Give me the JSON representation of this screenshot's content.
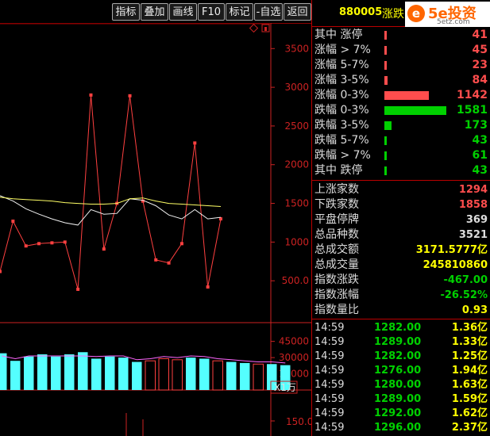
{
  "toolbar": {
    "buttons": [
      "指标",
      "叠加",
      "画线",
      "F10",
      "标记",
      "-自选",
      "返回"
    ]
  },
  "header": {
    "code": "880005",
    "name": "涨跌",
    "logo_text": "5e投资",
    "logo_sub": "5etz.com"
  },
  "colors": {
    "up": "#ff4d4d",
    "down": "#00d000",
    "yellow": "#ffff00",
    "axis": "#cc2222"
  },
  "price_axis": {
    "ticks": [
      "3500",
      "3000",
      "2500",
      "2000",
      "1500",
      "1000",
      "500.0"
    ]
  },
  "volume_axis": {
    "ticks": [
      "45000",
      "30000",
      "15000"
    ],
    "unit": "X1万",
    "lower_tick": "150.0"
  },
  "distribution": [
    {
      "label": "其中 涨停",
      "value": "41",
      "kind": "up",
      "count": 41
    },
    {
      "label": "涨幅 > 7%",
      "value": "45",
      "kind": "up",
      "count": 45
    },
    {
      "label": "涨幅 5-7%",
      "value": "23",
      "kind": "up",
      "count": 23
    },
    {
      "label": "涨幅 3-5%",
      "value": "84",
      "kind": "up",
      "count": 84
    },
    {
      "label": "涨幅 0-3%",
      "value": "1142",
      "kind": "up",
      "count": 1142
    },
    {
      "label": "跌幅 0-3%",
      "value": "1581",
      "kind": "down",
      "count": 1581
    },
    {
      "label": "跌幅 3-5%",
      "value": "173",
      "kind": "down",
      "count": 173
    },
    {
      "label": "跌幅 5-7%",
      "value": "43",
      "kind": "down",
      "count": 43
    },
    {
      "label": "跌幅 > 7%",
      "value": "61",
      "kind": "down",
      "count": 61
    },
    {
      "label": "其中 跌停",
      "value": "43",
      "kind": "down",
      "count": 43
    }
  ],
  "stats": [
    {
      "label": "上涨家数",
      "value": "1294",
      "color": "#ff4d4d"
    },
    {
      "label": "下跌家数",
      "value": "1858",
      "color": "#ff4d4d"
    },
    {
      "label": "平盘停牌",
      "value": "369",
      "color": "#dddddd"
    },
    {
      "label": "总品种数",
      "value": "3521",
      "color": "#dddddd"
    },
    {
      "label": "总成交额",
      "value": "3171.5777亿",
      "color": "#ffff00"
    },
    {
      "label": "总成交量",
      "value": "245810860",
      "color": "#ffff00"
    },
    {
      "label": "指数涨跌",
      "value": "-467.00",
      "color": "#00d000"
    },
    {
      "label": "指数涨幅",
      "value": "-26.52%",
      "color": "#00d000"
    },
    {
      "label": "指数量比",
      "value": "0.93",
      "color": "#ffff00"
    }
  ],
  "ticks": [
    {
      "time": "14:59",
      "price": "1282.00",
      "amount": "1.36亿"
    },
    {
      "time": "14:59",
      "price": "1289.00",
      "amount": "1.33亿"
    },
    {
      "time": "14:59",
      "price": "1282.00",
      "amount": "1.25亿"
    },
    {
      "time": "14:59",
      "price": "1276.00",
      "amount": "1.94亿"
    },
    {
      "time": "14:59",
      "price": "1280.00",
      "amount": "1.63亿"
    },
    {
      "time": "14:59",
      "price": "1289.00",
      "amount": "1.59亿"
    },
    {
      "time": "14:59",
      "price": "1292.00",
      "amount": "1.62亿"
    },
    {
      "time": "14:59",
      "price": "1296.00",
      "amount": "2.37亿"
    }
  ],
  "chart_data": {
    "type": "line",
    "ylim": [
      0,
      3800
    ],
    "series": [
      {
        "values": [
          620,
          1270,
          950,
          980,
          990,
          1000,
          390,
          2900,
          910,
          1500,
          2890,
          1530,
          770,
          730,
          980,
          2280,
          420,
          1300
        ]
      },
      {
        "values": [
          1600,
          1530,
          1430,
          1360,
          1300,
          1250,
          1220,
          1420,
          1360,
          1370,
          1560,
          1540,
          1470,
          1350,
          1300,
          1420,
          1300,
          1320
        ]
      },
      {
        "values": [
          1580,
          1560,
          1550,
          1540,
          1530,
          1510,
          1500,
          1490,
          1490,
          1500,
          1560,
          1570,
          1530,
          1500,
          1490,
          1480,
          1470,
          1460
        ]
      }
    ],
    "volume": [
      34000,
      27000,
      31000,
      33000,
      31000,
      33000,
      35000,
      29000,
      31000,
      30000,
      26000,
      27000,
      29000,
      28000,
      30000,
      29000,
      27000,
      26000,
      25000,
      24000,
      24000,
      23000
    ],
    "volume_kind": [
      "up",
      "up",
      "up",
      "up",
      "up",
      "up",
      "up",
      "up",
      "up",
      "up",
      "up",
      "down",
      "down",
      "down",
      "up",
      "up",
      "down",
      "up",
      "up",
      "down",
      "up",
      "up"
    ],
    "volume_ylim": [
      0,
      55000
    ]
  }
}
